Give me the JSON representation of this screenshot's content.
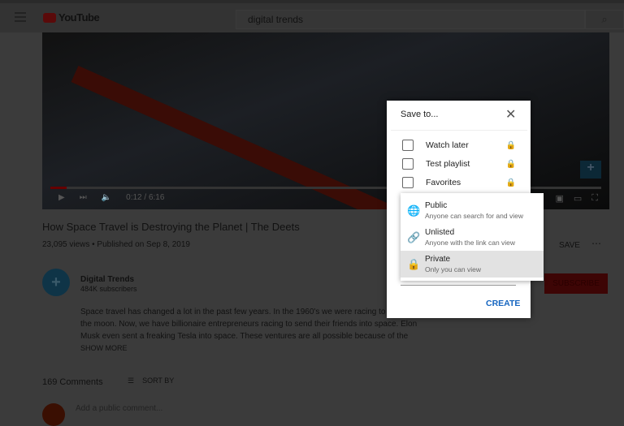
{
  "header": {
    "logo": "YouTube",
    "search_value": "digital trends"
  },
  "player": {
    "time": "0:12 / 6:16",
    "progress": 0.03
  },
  "video": {
    "title": "How Space Travel is Destroying the Planet | The Deets",
    "meta": "23,095 views • Published on Sep 8, 2019",
    "save_label": "SAVE",
    "more": "⋯"
  },
  "channel": {
    "name": "Digital Trends",
    "subscribers": "484K subscribers",
    "subscribe_label": "SUBSCRIBE"
  },
  "description": {
    "lines": [
      "Space travel has changed a lot in the past few years. In the 1960's we were racing to",
      "the moon. Now, we have billionaire entrepreneurs racing to send their friends into space. Elon",
      "Musk even sent a freaking Tesla into space. These ventures are all possible because of the"
    ],
    "show_more": "SHOW MORE"
  },
  "comments": {
    "count": "169 Comments",
    "sort": "SORT BY",
    "placeholder": "Add a public comment..."
  },
  "dialog": {
    "title": "Save to...",
    "playlists": [
      {
        "label": "Watch later"
      },
      {
        "label": "Test playlist"
      },
      {
        "label": "Favorites"
      }
    ],
    "create": "CREATE",
    "privacy": [
      {
        "name": "Public",
        "desc": "Anyone can search for and view",
        "icon": "globe-icon"
      },
      {
        "name": "Unlisted",
        "desc": "Anyone with the link can view",
        "icon": "link-icon"
      },
      {
        "name": "Private",
        "desc": "Only you can view",
        "icon": "lock-icon",
        "selected": true
      }
    ]
  },
  "colors": {
    "accent": "#1565c0",
    "selected_bg": "#e2e2e2"
  }
}
